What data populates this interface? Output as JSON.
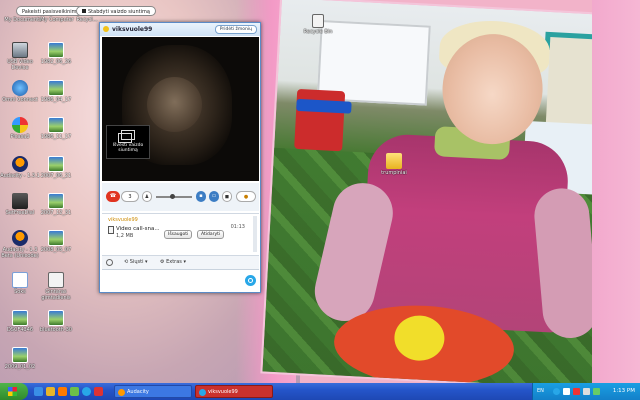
{
  "top_buttons": {
    "new_call": "Pakeisti pasisveikinimą",
    "stop_video": "Stabdyti vaizdo siuntimą"
  },
  "desktop_top_labels": [
    "My Documents",
    "My Computer",
    "Recycl..."
  ],
  "desktop_top_right_label": "Recycle Bin",
  "desktop_icons_col1": [
    {
      "label": "USB Video Device",
      "icon": "usb-icon"
    },
    {
      "label": "Omni Connect",
      "icon": "globe-icon"
    },
    {
      "label": "Picasa3",
      "icon": "picasa-icon"
    },
    {
      "label": "Audacity - 1.3.1",
      "icon": "audacity-icon"
    },
    {
      "label": "SetFreeDial",
      "icon": "setfree-icon"
    },
    {
      "label": "Audacity - 1.3 Beta (Unicode)",
      "icon": "audacity-icon"
    },
    {
      "label": "Šoks",
      "icon": "doc-icon"
    },
    {
      "label": "DSCF4346",
      "icon": "image-icon"
    },
    {
      "label": "2009_01_02",
      "icon": "image-icon"
    }
  ],
  "desktop_icons_col2": [
    {
      "label": "1982_06_26",
      "icon": "image-icon"
    },
    {
      "label": "1986_04_17",
      "icon": "image-icon"
    },
    {
      "label": "1986_11_17",
      "icon": "image-icon"
    },
    {
      "label": "2007_06_21",
      "icon": "image-icon"
    },
    {
      "label": "2007_12_31",
      "icon": "image-icon"
    },
    {
      "label": "2008_05_07",
      "icon": "image-icon"
    },
    {
      "label": "Gintaras gimtadienis",
      "icon": "mp3-icon"
    },
    {
      "label": "bluetooth-30",
      "icon": "image-icon"
    }
  ],
  "desktop_folder": {
    "label": "trumpiniai",
    "icon": "folder-icon"
  },
  "skype": {
    "contact": "viksvuole99",
    "add_button": "Pridėti žmonių",
    "self_view_label": "Išvesti vaizdo siuntimą",
    "call_count": "3",
    "chat": {
      "sender": "viksvuole99",
      "time": "01:13",
      "file_name": "Video call-sna...",
      "file_size": "1,2 MB",
      "save_button": "Išsaugoti",
      "open_button": "Atidaryti"
    },
    "toolbar": {
      "send": "Siųsti",
      "extras": "Extras"
    }
  },
  "taskbar": {
    "tasks": [
      {
        "label": "Audacity",
        "icon": "audacity-icon"
      },
      {
        "label": "viksvuole99",
        "icon": "skype-icon",
        "active": true
      }
    ],
    "language": "EN",
    "clock": "1:13 PM"
  },
  "colors": {
    "taskbar_blue": "#2555c9",
    "start_green": "#2f8a2c",
    "skype_blue": "#28a7e8",
    "active_task_red": "#c9312d"
  }
}
